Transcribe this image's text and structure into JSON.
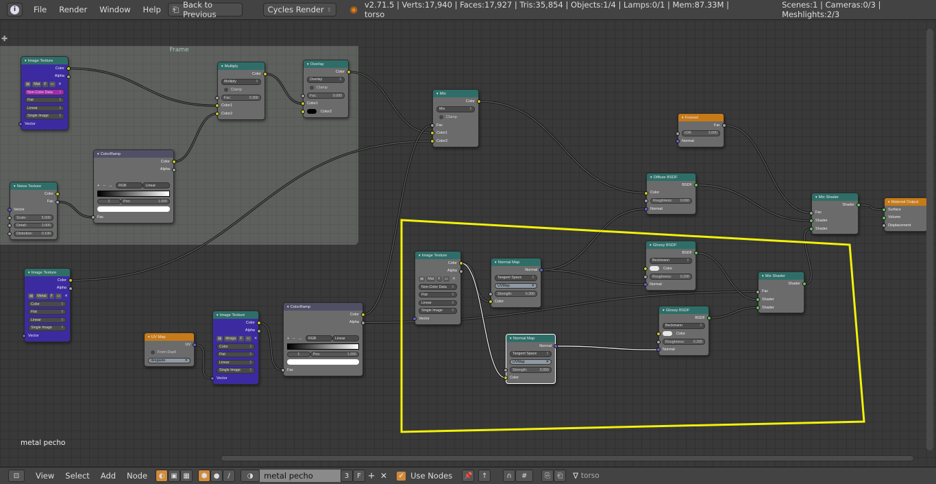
{
  "topbar": {
    "info_icon": "info-icon",
    "menus": [
      "File",
      "Render",
      "Window",
      "Help"
    ],
    "back_button": "Back to Previous",
    "engine": "Cycles Render",
    "stats": "v2.71.5 | Verts:17,940 | Faces:17,927 | Tris:35,854 | Objects:1/4 | Lamps:0/1 | Mem:87.33M | torso",
    "scene_stats": "Scenes:1 | Cameras:0/3 | Meshlights:2/3"
  },
  "frame": {
    "label": "Frame"
  },
  "editor": {
    "material_name_overlay": "metal pecho"
  },
  "socket_colors": {
    "color": "#c7c729",
    "float": "#a1a1a1",
    "vector": "#6363c7",
    "shader": "#63c763"
  },
  "header_colors": {
    "texture": "#2f6e68",
    "converter": "#2f6e68",
    "ramp": "#4f4f66",
    "input": "#c77a18",
    "output": "#c77a18",
    "shader": "#2f6e68"
  },
  "annotation_color": "#f2f20a",
  "nodes": [
    {
      "title": "Image Texture",
      "kind": "texture",
      "body": "purple",
      "rows": [
        {
          "t": "out",
          "label": "Color",
          "sock": "color"
        },
        {
          "t": "out",
          "label": "Alpha",
          "sock": "float"
        },
        {
          "t": "image",
          "label": "Mat"
        },
        {
          "t": "select",
          "label": "Non-Color Data",
          "hl": true
        },
        {
          "t": "select",
          "label": "Flat"
        },
        {
          "t": "select",
          "label": "Linear"
        },
        {
          "t": "select",
          "label": "Single Image"
        },
        {
          "t": "in",
          "label": "Vector",
          "sock": "vector"
        }
      ]
    },
    {
      "title": "Multiply",
      "kind": "converter",
      "rows": [
        {
          "t": "out",
          "label": "Color",
          "sock": "color"
        },
        {
          "t": "select",
          "label": "Multiply"
        },
        {
          "t": "check",
          "label": "Clamp"
        },
        {
          "t": "field",
          "label": "Fac:",
          "value": "0.300",
          "sock": "float"
        },
        {
          "t": "in",
          "label": "Color1",
          "sock": "color"
        },
        {
          "t": "in",
          "label": "Color2",
          "sock": "color"
        }
      ]
    },
    {
      "title": "Overlay",
      "kind": "converter",
      "rows": [
        {
          "t": "out",
          "label": "Color",
          "sock": "color"
        },
        {
          "t": "select",
          "label": "Overlay"
        },
        {
          "t": "check",
          "label": "Clamp"
        },
        {
          "t": "field",
          "label": "Fac:",
          "value": "0.000",
          "sock": "float"
        },
        {
          "t": "in",
          "label": "Color1",
          "sock": "color"
        },
        {
          "t": "in",
          "label": "Color2",
          "sock": "color",
          "swatch": "#000000"
        }
      ]
    },
    {
      "title": "ColorRamp",
      "kind": "ramp",
      "rows": [
        {
          "t": "out",
          "label": "Color",
          "sock": "color"
        },
        {
          "t": "out",
          "label": "Alpha",
          "sock": "float"
        },
        {
          "t": "spacer"
        },
        {
          "t": "rampctrl",
          "mode": "RGB",
          "interp": "Linear"
        },
        {
          "t": "rampbar"
        },
        {
          "t": "ramppos",
          "index": "1",
          "label": "Pos:",
          "value": "1.000"
        },
        {
          "t": "rampsw"
        },
        {
          "t": "in",
          "label": "Fac",
          "sock": "float"
        }
      ]
    },
    {
      "title": "Noise Texture",
      "kind": "texture",
      "rows": [
        {
          "t": "out",
          "label": "Color",
          "sock": "color"
        },
        {
          "t": "out",
          "label": "Fac",
          "sock": "float"
        },
        {
          "t": "in",
          "label": "Vector",
          "sock": "vector"
        },
        {
          "t": "field",
          "label": "Scale:",
          "value": "5.000",
          "sock": "float"
        },
        {
          "t": "field",
          "label": "Detail:",
          "value": "2.000",
          "sock": "float"
        },
        {
          "t": "field",
          "label": "Distortion:",
          "value": "0.100",
          "sock": "float"
        }
      ]
    },
    {
      "title": "Mix",
      "kind": "converter",
      "rows": [
        {
          "t": "out",
          "label": "Color",
          "sock": "color"
        },
        {
          "t": "select",
          "label": "Mix"
        },
        {
          "t": "check",
          "label": "Clamp"
        },
        {
          "t": "in",
          "label": "Fac",
          "sock": "float"
        },
        {
          "t": "in",
          "label": "Color1",
          "sock": "color"
        },
        {
          "t": "in",
          "label": "Color2",
          "sock": "color"
        }
      ]
    },
    {
      "title": "Fresnel",
      "kind": "input",
      "rows": [
        {
          "t": "out",
          "label": "Fac",
          "sock": "float"
        },
        {
          "t": "field",
          "label": "IOR:",
          "value": "3.000",
          "sock": "float"
        },
        {
          "t": "in",
          "label": "Normal",
          "sock": "vector"
        }
      ]
    },
    {
      "title": "Diffuse BSDF",
      "kind": "shader",
      "rows": [
        {
          "t": "out",
          "label": "BSDF",
          "sock": "shader"
        },
        {
          "t": "in",
          "label": "Color",
          "sock": "color"
        },
        {
          "t": "field",
          "label": "Roughness:",
          "value": "0.000",
          "sock": "float"
        },
        {
          "t": "in",
          "label": "Normal",
          "sock": "vector"
        }
      ]
    },
    {
      "title": "Mix Shader",
      "kind": "shader",
      "rows": [
        {
          "t": "out",
          "label": "Shader",
          "sock": "shader"
        },
        {
          "t": "in",
          "label": "Fac",
          "sock": "float"
        },
        {
          "t": "in",
          "label": "Shader",
          "sock": "shader"
        },
        {
          "t": "in",
          "label": "Shader",
          "sock": "shader"
        }
      ]
    },
    {
      "title": "Material Output",
      "kind": "output",
      "rows": [
        {
          "t": "in",
          "label": "Surface",
          "sock": "shader"
        },
        {
          "t": "in",
          "label": "Volume",
          "sock": "shader"
        },
        {
          "t": "in",
          "label": "Displacement",
          "sock": "float"
        }
      ]
    },
    {
      "title": "Image Texture",
      "kind": "texture",
      "body": "purple",
      "rows": [
        {
          "t": "out",
          "label": "Color",
          "sock": "color"
        },
        {
          "t": "out",
          "label": "Alpha",
          "sock": "float"
        },
        {
          "t": "image",
          "label": "Metal"
        },
        {
          "t": "select",
          "label": "Color"
        },
        {
          "t": "select",
          "label": "Flat"
        },
        {
          "t": "select",
          "label": "Linear"
        },
        {
          "t": "select",
          "label": "Single Image"
        },
        {
          "t": "in",
          "label": "Vector",
          "sock": "vector"
        }
      ]
    },
    {
      "title": "UV Map",
      "kind": "input",
      "rows": [
        {
          "t": "out",
          "label": "UV",
          "sock": "vector"
        },
        {
          "t": "check",
          "label": "From Dupli"
        },
        {
          "t": "uv",
          "label": "desgaste"
        }
      ]
    },
    {
      "title": "Image Texture",
      "kind": "texture",
      "body": "purple",
      "rows": [
        {
          "t": "out",
          "label": "Color",
          "sock": "color"
        },
        {
          "t": "out",
          "label": "Alpha",
          "sock": "float"
        },
        {
          "t": "image",
          "label": "desga"
        },
        {
          "t": "select",
          "label": "Color"
        },
        {
          "t": "select",
          "label": "Flat"
        },
        {
          "t": "select",
          "label": "Linear"
        },
        {
          "t": "select",
          "label": "Single Image"
        },
        {
          "t": "in",
          "label": "Vector",
          "sock": "vector"
        }
      ]
    },
    {
      "title": "ColorRamp",
      "kind": "ramp",
      "rows": [
        {
          "t": "out",
          "label": "Color",
          "sock": "color"
        },
        {
          "t": "out",
          "label": "Alpha",
          "sock": "float"
        },
        {
          "t": "spacer"
        },
        {
          "t": "rampctrl",
          "mode": "RGB",
          "interp": "Linear"
        },
        {
          "t": "rampbar"
        },
        {
          "t": "ramppos",
          "index": "1",
          "label": "Pos:",
          "value": "1.000"
        },
        {
          "t": "rampsw"
        },
        {
          "t": "in",
          "label": "Fac",
          "sock": "float"
        }
      ]
    },
    {
      "title": "Image Texture",
      "kind": "texture",
      "rows": [
        {
          "t": "out",
          "label": "Color",
          "sock": "color"
        },
        {
          "t": "out",
          "label": "Alpha",
          "sock": "float"
        },
        {
          "t": "image",
          "label": "Mat"
        },
        {
          "t": "select",
          "label": "Non-Color Data"
        },
        {
          "t": "select",
          "label": "Flat"
        },
        {
          "t": "select",
          "label": "Linear"
        },
        {
          "t": "select",
          "label": "Single Image"
        },
        {
          "t": "in",
          "label": "Vector",
          "sock": "vector"
        }
      ]
    },
    {
      "title": "Normal Map",
      "kind": "converter",
      "rows": [
        {
          "t": "out",
          "label": "Normal",
          "sock": "vector"
        },
        {
          "t": "select",
          "label": "Tangent Space"
        },
        {
          "t": "uv",
          "label": "UVMap"
        },
        {
          "t": "field",
          "label": "Strength:",
          "value": "0.300",
          "sock": "float"
        },
        {
          "t": "in",
          "label": "Color",
          "sock": "color"
        }
      ]
    },
    {
      "title": "Normal Map",
      "kind": "converter",
      "selected": true,
      "rows": [
        {
          "t": "out",
          "label": "Normal",
          "sock": "vector"
        },
        {
          "t": "select",
          "label": "Tangent Space"
        },
        {
          "t": "uv",
          "label": "UVMap"
        },
        {
          "t": "field",
          "label": "Strength:",
          "value": "0.050",
          "sock": "float"
        },
        {
          "t": "in",
          "label": "Color",
          "sock": "color"
        }
      ]
    },
    {
      "title": "Glossy BSDF",
      "kind": "shader",
      "rows": [
        {
          "t": "out",
          "label": "BSDF",
          "sock": "shader"
        },
        {
          "t": "select",
          "label": "Beckmann"
        },
        {
          "t": "in",
          "label": "Color",
          "sock": "color",
          "swatch": "#e8e8e8"
        },
        {
          "t": "field",
          "label": "Roughness:",
          "value": "0.200",
          "sock": "float"
        },
        {
          "t": "in",
          "label": "Normal",
          "sock": "vector"
        }
      ]
    },
    {
      "title": "Glossy BSDF",
      "kind": "shader",
      "rows": [
        {
          "t": "out",
          "label": "BSDF",
          "sock": "shader"
        },
        {
          "t": "select",
          "label": "Beckmann"
        },
        {
          "t": "in",
          "label": "Color",
          "sock": "color",
          "swatch": "#e8e8e8"
        },
        {
          "t": "field",
          "label": "Roughness:",
          "value": "0.200",
          "sock": "float"
        },
        {
          "t": "in",
          "label": "Normal",
          "sock": "vector"
        }
      ]
    },
    {
      "title": "Mix Shader",
      "kind": "shader",
      "rows": [
        {
          "t": "out",
          "label": "Shader",
          "sock": "shader"
        },
        {
          "t": "in",
          "label": "Fac",
          "sock": "float"
        },
        {
          "t": "in",
          "label": "Shader",
          "sock": "shader"
        },
        {
          "t": "in",
          "label": "Shader",
          "sock": "shader"
        }
      ]
    }
  ],
  "bottombar": {
    "menus": [
      "View",
      "Select",
      "Add",
      "Node"
    ],
    "material": "metal pecho",
    "users": "3",
    "fake_user": "F",
    "use_nodes": "Use Nodes",
    "use_nodes_checked": true,
    "object": "torso"
  }
}
